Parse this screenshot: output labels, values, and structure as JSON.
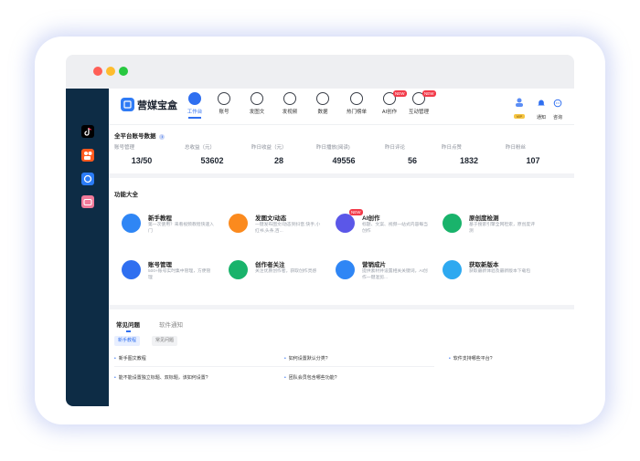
{
  "app": {
    "name": "营媒宝盒"
  },
  "nav": [
    {
      "label": "工作台",
      "icon": "workbench-icon"
    },
    {
      "label": "账号",
      "icon": "account-icon"
    },
    {
      "label": "发图文",
      "icon": "post-image-text-icon"
    },
    {
      "label": "发视频",
      "icon": "post-video-icon"
    },
    {
      "label": "数据",
      "icon": "data-icon"
    },
    {
      "label": "热门榜单",
      "icon": "hot-list-icon"
    },
    {
      "label": "AI创作",
      "icon": "ai-create-icon",
      "badge": "NEW"
    },
    {
      "label": "互动管理",
      "icon": "interaction-icon",
      "badge": "NEW"
    }
  ],
  "header_right": {
    "vip_badge": "VIP",
    "notify_label": "通知",
    "consult_label": "咨询"
  },
  "stats_section": {
    "title": "全平台账号数据"
  },
  "stats": [
    {
      "label": "账号管理",
      "value": "13/50"
    },
    {
      "label": "总收益（元）",
      "value": "53602"
    },
    {
      "label": "昨日收益（元）",
      "value": "28"
    },
    {
      "label": "昨日播放(阅读)",
      "value": "49556"
    },
    {
      "label": "昨日评论",
      "value": "56"
    },
    {
      "label": "昨日点赞",
      "value": "1832"
    },
    {
      "label": "昨日粉丝",
      "value": "107"
    }
  ],
  "features_section": {
    "title": "功能大全"
  },
  "features": [
    {
      "name": "新手教程",
      "desc": "第一次使用？来看视频教程快速入门",
      "color": "#2f86f5"
    },
    {
      "name": "发图文/动态",
      "desc": "一键发布图文/动态到抖音,快手,小红书,头条,百...",
      "color": "#fb8a1e"
    },
    {
      "name": "AI创作",
      "desc": "标题、文案、视频一站式内容每当创作",
      "color": "#5b57e8",
      "badge": "NEW"
    },
    {
      "name": "原创度检测",
      "desc": "基于搜索引擎全网检索，原创度评测",
      "color": "#19b36b"
    },
    {
      "name": "账号管理",
      "desc": "500+账号实时集中管理，方便管理",
      "color": "#2f6ff0"
    },
    {
      "name": "创作者关注",
      "desc": "关注优质创作者，获取创作灵感",
      "color": "#19b36b"
    },
    {
      "name": "营销成片",
      "desc": "提供素材并设置相关关键词，AI创作一键混剪...",
      "color": "#2f86f5"
    },
    {
      "name": "获取新版本",
      "desc": "获取最新体验及最新版本下载包",
      "color": "#2ea9f0"
    }
  ],
  "tabs": {
    "faq": "常见问题",
    "notice": "软件通知"
  },
  "chips": {
    "newbie": "新手教程",
    "common": "常见问题"
  },
  "faqs": [
    "新手图文教程",
    "如何设置默认分类?",
    "软件支持哪些平台?",
    "能不能设置独立标题、双标题，该如何设置?",
    "团队会员包含哪些功能?"
  ],
  "colors": {
    "accent": "#2f6ff0",
    "sidebar": "#0d2c45",
    "badge": "#f23b4a"
  }
}
